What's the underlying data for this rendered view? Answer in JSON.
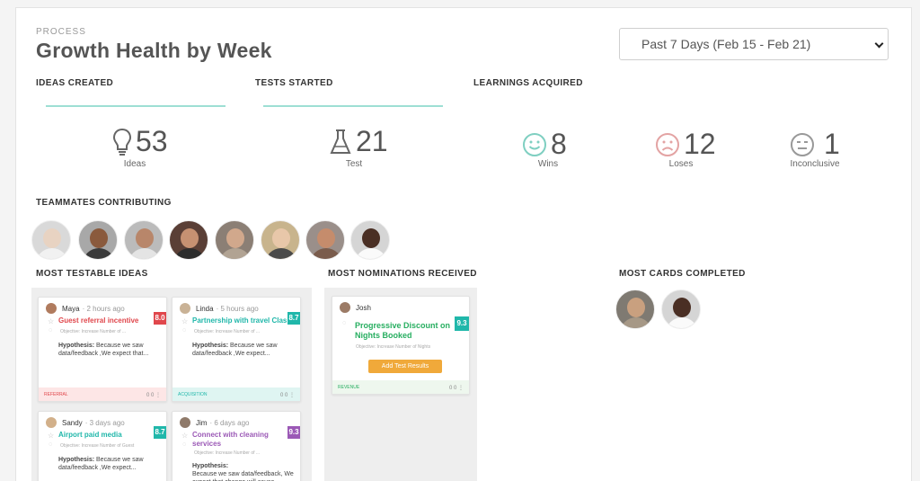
{
  "header": {
    "eyebrow": "PROCESS",
    "title": "Growth Health by Week",
    "date_range": "Past 7 Days (Feb 15 - Feb 21)"
  },
  "sections": {
    "ideas_created": "IDEAS CREATED",
    "tests_started": "TESTS STARTED",
    "learnings": "LEARNINGS ACQUIRED",
    "teammates": "TEAMMATES CONTRIBUTING",
    "most_testable": "MOST TESTABLE IDEAS",
    "most_nominations": "MOST NOMINATIONS RECEIVED",
    "most_cards": "MOST CARDS COMPLETED"
  },
  "metrics": {
    "ideas": {
      "value": "53",
      "label": "Ideas",
      "icon": "lightbulb-icon"
    },
    "tests": {
      "value": "21",
      "label": "Test",
      "icon": "flask-icon"
    },
    "wins": {
      "value": "8",
      "label": "Wins",
      "icon": "smile-icon",
      "color": "#7fcfc1"
    },
    "loses": {
      "value": "12",
      "label": "Loses",
      "icon": "frown-icon",
      "color": "#e3a3a3"
    },
    "inconclusive": {
      "value": "1",
      "label": "Inconclusive",
      "icon": "neutral-face-icon",
      "color": "#999999"
    }
  },
  "colors": {
    "accent_line": "#9edfd4",
    "red": "#e0474c",
    "teal": "#20b7aa",
    "purple": "#9b59b6",
    "green": "#27ae60",
    "orange": "#f0a93a"
  },
  "testable_cards": [
    {
      "name": "Maya",
      "time": "· 2 hours ago",
      "title": "Guest referral incentive",
      "score": "8.0",
      "meta": "Objective: Increase Number of ...",
      "hyp_label": "Hypothesis:",
      "hyp_text": "Because we saw data/feedback ,We expect that...",
      "footer": "REFERRAL",
      "stats": "0  0  ⋮"
    },
    {
      "name": "Linda",
      "time": "· 5 hours ago",
      "title": "Partnership with travel Clas",
      "score": "8.7",
      "meta": "Objective: Increase Number of ...",
      "hyp_label": "Hypothesis:",
      "hyp_text": "Because we saw data/feedback ,We expect...",
      "footer": "ACQUISITION",
      "stats": "0  0  ⋮"
    },
    {
      "name": "Sandy",
      "time": "· 3 days ago",
      "title": "Airport paid media",
      "score": "8.7",
      "meta": "Objective: Increase Number of Guest",
      "hyp_label": "Hypothesis:",
      "hyp_text": "Because we saw data/feedback ,We expect..."
    },
    {
      "name": "Jim",
      "time": "· 6 days ago",
      "title": "Connect with cleaning services",
      "score": "9.3",
      "meta": "Objective: Increase Number of ...",
      "hyp_label": "Hypothesis:",
      "hyp_text": "Because we saw data/feedback, We expect that change will cause impact..."
    }
  ],
  "nomination_card": {
    "name": "Josh",
    "title": "Progressive Discount on Nights Booked",
    "score": "9.3",
    "meta": "Objective: Increase Number of Nights",
    "button": "Add Test Results",
    "footer": "REVENUE",
    "stats": "0  0  ⋮"
  }
}
